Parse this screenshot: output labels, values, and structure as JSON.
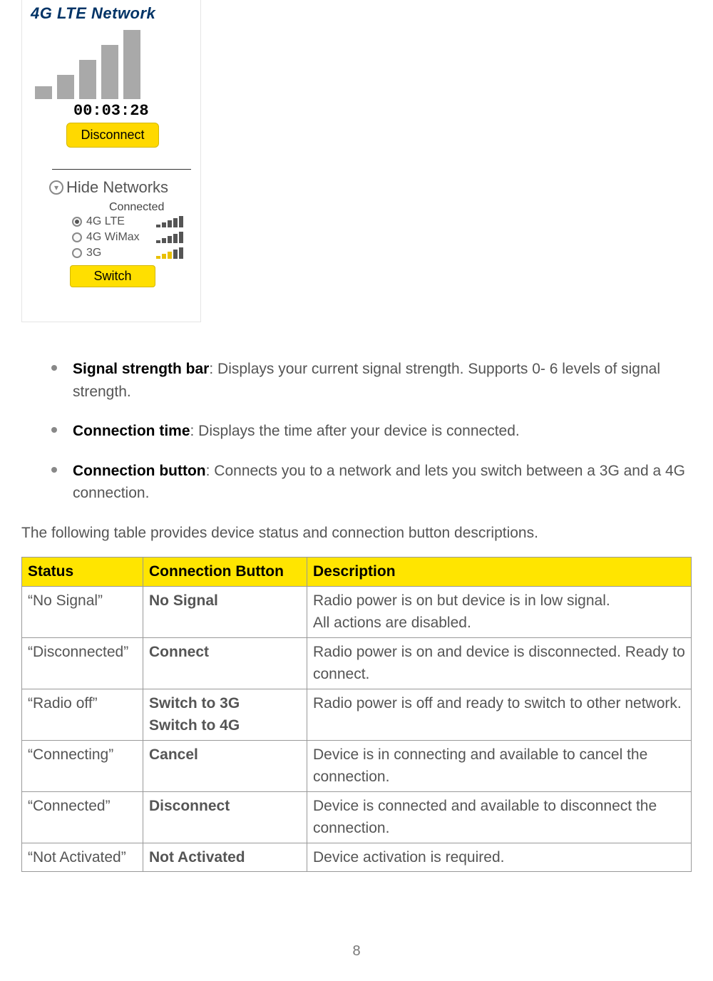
{
  "widget": {
    "title": "4G LTE Network",
    "timer": "00:03:28",
    "disconnect_label": "Disconnect",
    "hide_label": "Hide Networks",
    "connected_label": "Connected",
    "networks": [
      {
        "label": "4G LTE",
        "selected": true,
        "bars_color": "#555"
      },
      {
        "label": "4G WiMax",
        "selected": false,
        "bars_color": "#555"
      },
      {
        "label": "3G",
        "selected": false,
        "bars_color": "#e9c000"
      }
    ],
    "switch_label": "Switch"
  },
  "bullets": [
    {
      "title": "Signal strength bar",
      "text": ": Displays your current signal strength. Supports 0- 6 levels of signal strength."
    },
    {
      "title": "Connection time",
      "text": ": Displays the time after your device is connected."
    },
    {
      "title": "Connection button",
      "text": ": Connects you to a network and lets you switch between a 3G and a 4G connection."
    }
  ],
  "intro": "The following table provides device status and connection button descriptions.",
  "table": {
    "headers": {
      "status": "Status",
      "button": "Connection Button",
      "desc": "Description"
    },
    "rows": [
      {
        "status": "“No Signal”",
        "button": "No Signal",
        "desc": "Radio power is on but device is in low signal.\nAll actions are disabled."
      },
      {
        "status": "“Disconnected”",
        "button": "Connect",
        "desc": "Radio power is on and device is disconnected. Ready to connect."
      },
      {
        "status": "“Radio off”",
        "button": "Switch to 3G\nSwitch to 4G",
        "desc": "Radio power is off and ready to switch to other network."
      },
      {
        "status": "“Connecting”",
        "button": "Cancel",
        "desc": "Device is in connecting and available to cancel the connection."
      },
      {
        "status": "“Connected”",
        "button": "Disconnect",
        "desc": "Device is connected and available to disconnect the connection."
      },
      {
        "status": "“Not Activated”",
        "button": "Not Activated",
        "desc": "Device activation is required."
      }
    ]
  },
  "page_number": "8"
}
